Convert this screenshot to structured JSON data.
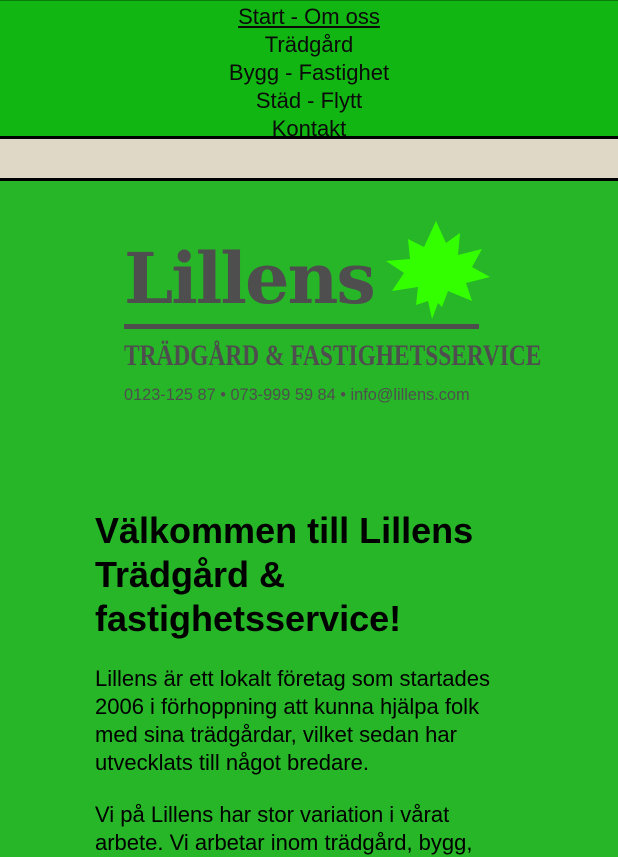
{
  "nav": {
    "items": [
      {
        "label": "Start - Om oss"
      },
      {
        "label": "Trädgård"
      },
      {
        "label": "Bygg - Fastighet"
      },
      {
        "label": "Städ - Flytt"
      },
      {
        "label": "Kontakt"
      }
    ]
  },
  "logo": {
    "title": "Lillens",
    "subtitle": "TRÄDGÅRD & FASTIGHETSSERVICE",
    "contact": "0123-125 87 • 073-999 59 84 • info@lillens.com",
    "leaf_color": "#33ff00"
  },
  "main": {
    "heading": "Välkommen till Lillens Trädgård & fastighetsservice!",
    "paragraphs": [
      "Lillens är ett lokalt företag som startades 2006 i förhoppning att kunna hjälpa folk med sina trädgårdar, vilket sedan har utvecklats till något bredare.",
      "Vi på Lillens har stor variation i vårat arbete. Vi arbetar inom trädgård, bygg,"
    ]
  }
}
